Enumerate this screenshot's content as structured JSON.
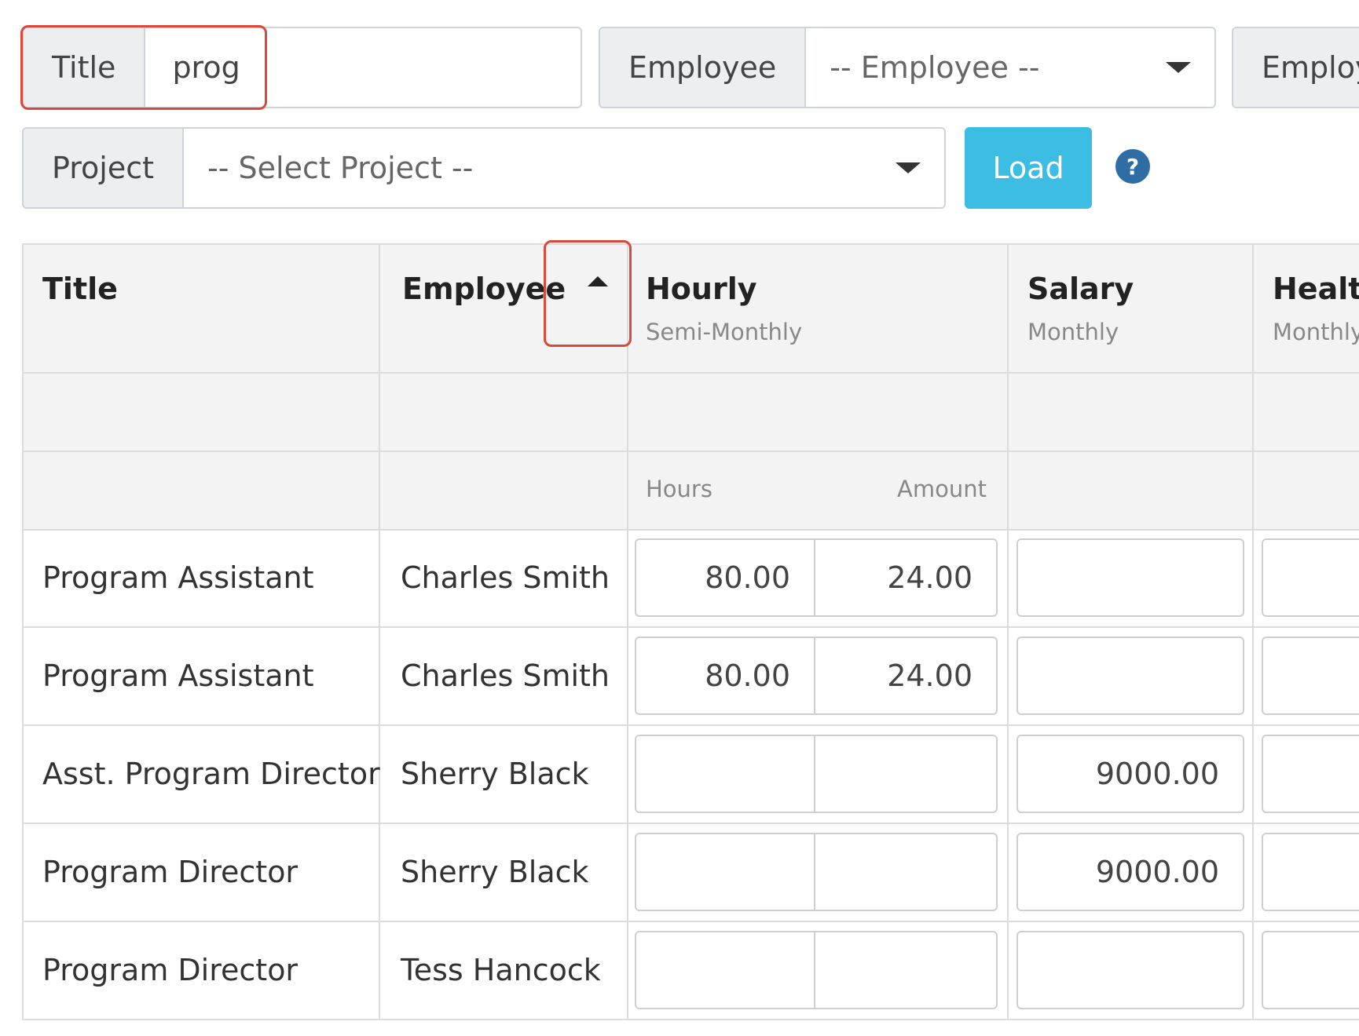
{
  "filters": {
    "title": {
      "label": "Title",
      "value": "prog"
    },
    "employee": {
      "label": "Employee",
      "placeholder": "-- Employee --"
    },
    "employee_type": {
      "label": "Employo"
    },
    "project": {
      "label": "Project",
      "placeholder": "-- Select Project --"
    },
    "load_label": "Load",
    "help_glyph": "?"
  },
  "table": {
    "headers": {
      "title": "Title",
      "employee": "Employee",
      "hourly": "Hourly",
      "hourly_sub": "Semi-Monthly",
      "salary": "Salary",
      "salary_sub": "Monthly",
      "health": "Healtl",
      "health_sub": "Monthly"
    },
    "subheaders": {
      "hours": "Hours",
      "amount": "Amount"
    },
    "rows": [
      {
        "title": "Program Assistant",
        "employee": "Charles Smith",
        "hours": "80.00",
        "amount": "24.00",
        "salary": ""
      },
      {
        "title": "Program Assistant",
        "employee": "Charles Smith",
        "hours": "80.00",
        "amount": "24.00",
        "salary": ""
      },
      {
        "title": "Asst. Program Director",
        "employee": "Sherry Black",
        "hours": "",
        "amount": "",
        "salary": "9000.00"
      },
      {
        "title": "Program Director",
        "employee": "Sherry Black",
        "hours": "",
        "amount": "",
        "salary": "9000.00"
      },
      {
        "title": "Program Director",
        "employee": "Tess Hancock",
        "hours": "",
        "amount": "",
        "salary": ""
      }
    ]
  }
}
